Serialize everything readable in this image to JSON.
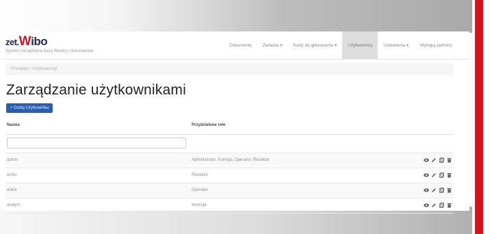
{
  "brand": {
    "prefix": "zet.",
    "initial": "W",
    "rest": "ibo",
    "tagline": "System zarządzania bazą Wiedzy i dokumentów"
  },
  "nav": {
    "items": [
      {
        "label": "Dokumenty",
        "active": false
      },
      {
        "label": "Zadania ▾",
        "active": false
      },
      {
        "label": "Karty do głosowania ▾",
        "active": false
      },
      {
        "label": "Użytkownicy",
        "active": true
      },
      {
        "label": "Ustawienia ▾",
        "active": false
      },
      {
        "label": "Wyloguj (admin)",
        "active": false
      }
    ]
  },
  "breadcrumb": "Przegląd / Użytkownicy",
  "page": {
    "title": "Zarządzanie użytkownikami",
    "add_button": "+ Dodaj Użytkownika"
  },
  "table": {
    "headers": {
      "name": "Nazwa",
      "roles": "Przydzielone role"
    },
    "filter_placeholder": "",
    "rows": [
      {
        "name": "admin",
        "roles": "Administrator, Komisja, Operator, Redaktor"
      },
      {
        "name": "writer",
        "roles": "Redaktor"
      },
      {
        "name": "editor",
        "roles": "Operator"
      },
      {
        "name": "analyst",
        "roles": "Komisja"
      }
    ]
  },
  "colors": {
    "brand_dark": "#1b2a55",
    "brand_red": "#d8111f",
    "button_blue": "#2a5fb0"
  },
  "icons": [
    "eye-icon",
    "pencil-icon",
    "copy-icon",
    "trash-icon"
  ]
}
